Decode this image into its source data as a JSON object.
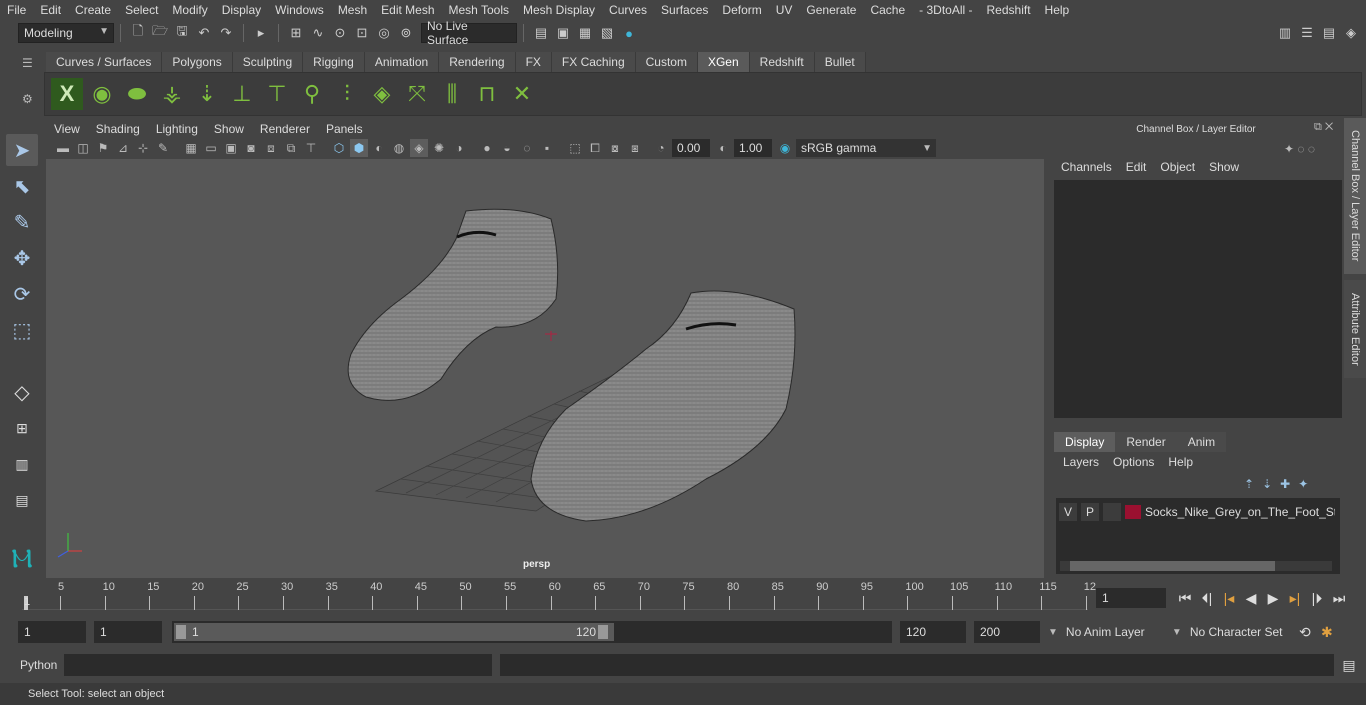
{
  "menubar": {
    "items": [
      "File",
      "Edit",
      "Create",
      "Select",
      "Modify",
      "Display",
      "Windows",
      "Mesh",
      "Edit Mesh",
      "Mesh Tools",
      "Mesh Display",
      "Curves",
      "Surfaces",
      "Deform",
      "UV",
      "Generate",
      "Cache",
      "- 3DtoAll -",
      "Redshift",
      "Help"
    ]
  },
  "statusline": {
    "mode": "Modeling",
    "live_surface": "No Live Surface"
  },
  "shelf": {
    "tabs": [
      "Curves / Surfaces",
      "Polygons",
      "Sculpting",
      "Rigging",
      "Animation",
      "Rendering",
      "FX",
      "FX Caching",
      "Custom",
      "XGen",
      "Redshift",
      "Bullet"
    ],
    "active_tab": "XGen"
  },
  "viewport": {
    "menu": [
      "View",
      "Shading",
      "Lighting",
      "Show",
      "Renderer",
      "Panels"
    ],
    "exposure": "0.00",
    "gamma": "1.00",
    "color_space": "sRGB gamma",
    "camera_label": "persp"
  },
  "channel_box": {
    "title": "Channel Box / Layer Editor",
    "menu": [
      "Channels",
      "Edit",
      "Object",
      "Show"
    ]
  },
  "layer_editor": {
    "tabs": [
      "Display",
      "Render",
      "Anim"
    ],
    "active_tab": "Display",
    "menu": [
      "Layers",
      "Options",
      "Help"
    ],
    "layer": {
      "v": "V",
      "p": "P",
      "name": "Socks_Nike_Grey_on_The_Foot_Stanc",
      "color": "#9a1030"
    }
  },
  "side_tabs": {
    "channel_box": "Channel Box / Layer Editor",
    "attribute_editor": "Attribute Editor"
  },
  "timeline": {
    "ticks": [
      "5",
      "10",
      "15",
      "20",
      "25",
      "30",
      "35",
      "40",
      "45",
      "50",
      "55",
      "60",
      "65",
      "70",
      "75",
      "80",
      "85",
      "90",
      "95",
      "100",
      "105",
      "110",
      "115",
      "12"
    ],
    "start_label": "1",
    "current_frame": "1"
  },
  "range": {
    "start": "1",
    "playback_start": "1",
    "slider_start": "1",
    "slider_end": "120",
    "playback_end": "120",
    "end": "200",
    "anim_layer": "No Anim Layer",
    "character_set": "No Character Set"
  },
  "command_line": {
    "label": "Python"
  },
  "help_line": {
    "text": "Select Tool: select an object"
  }
}
